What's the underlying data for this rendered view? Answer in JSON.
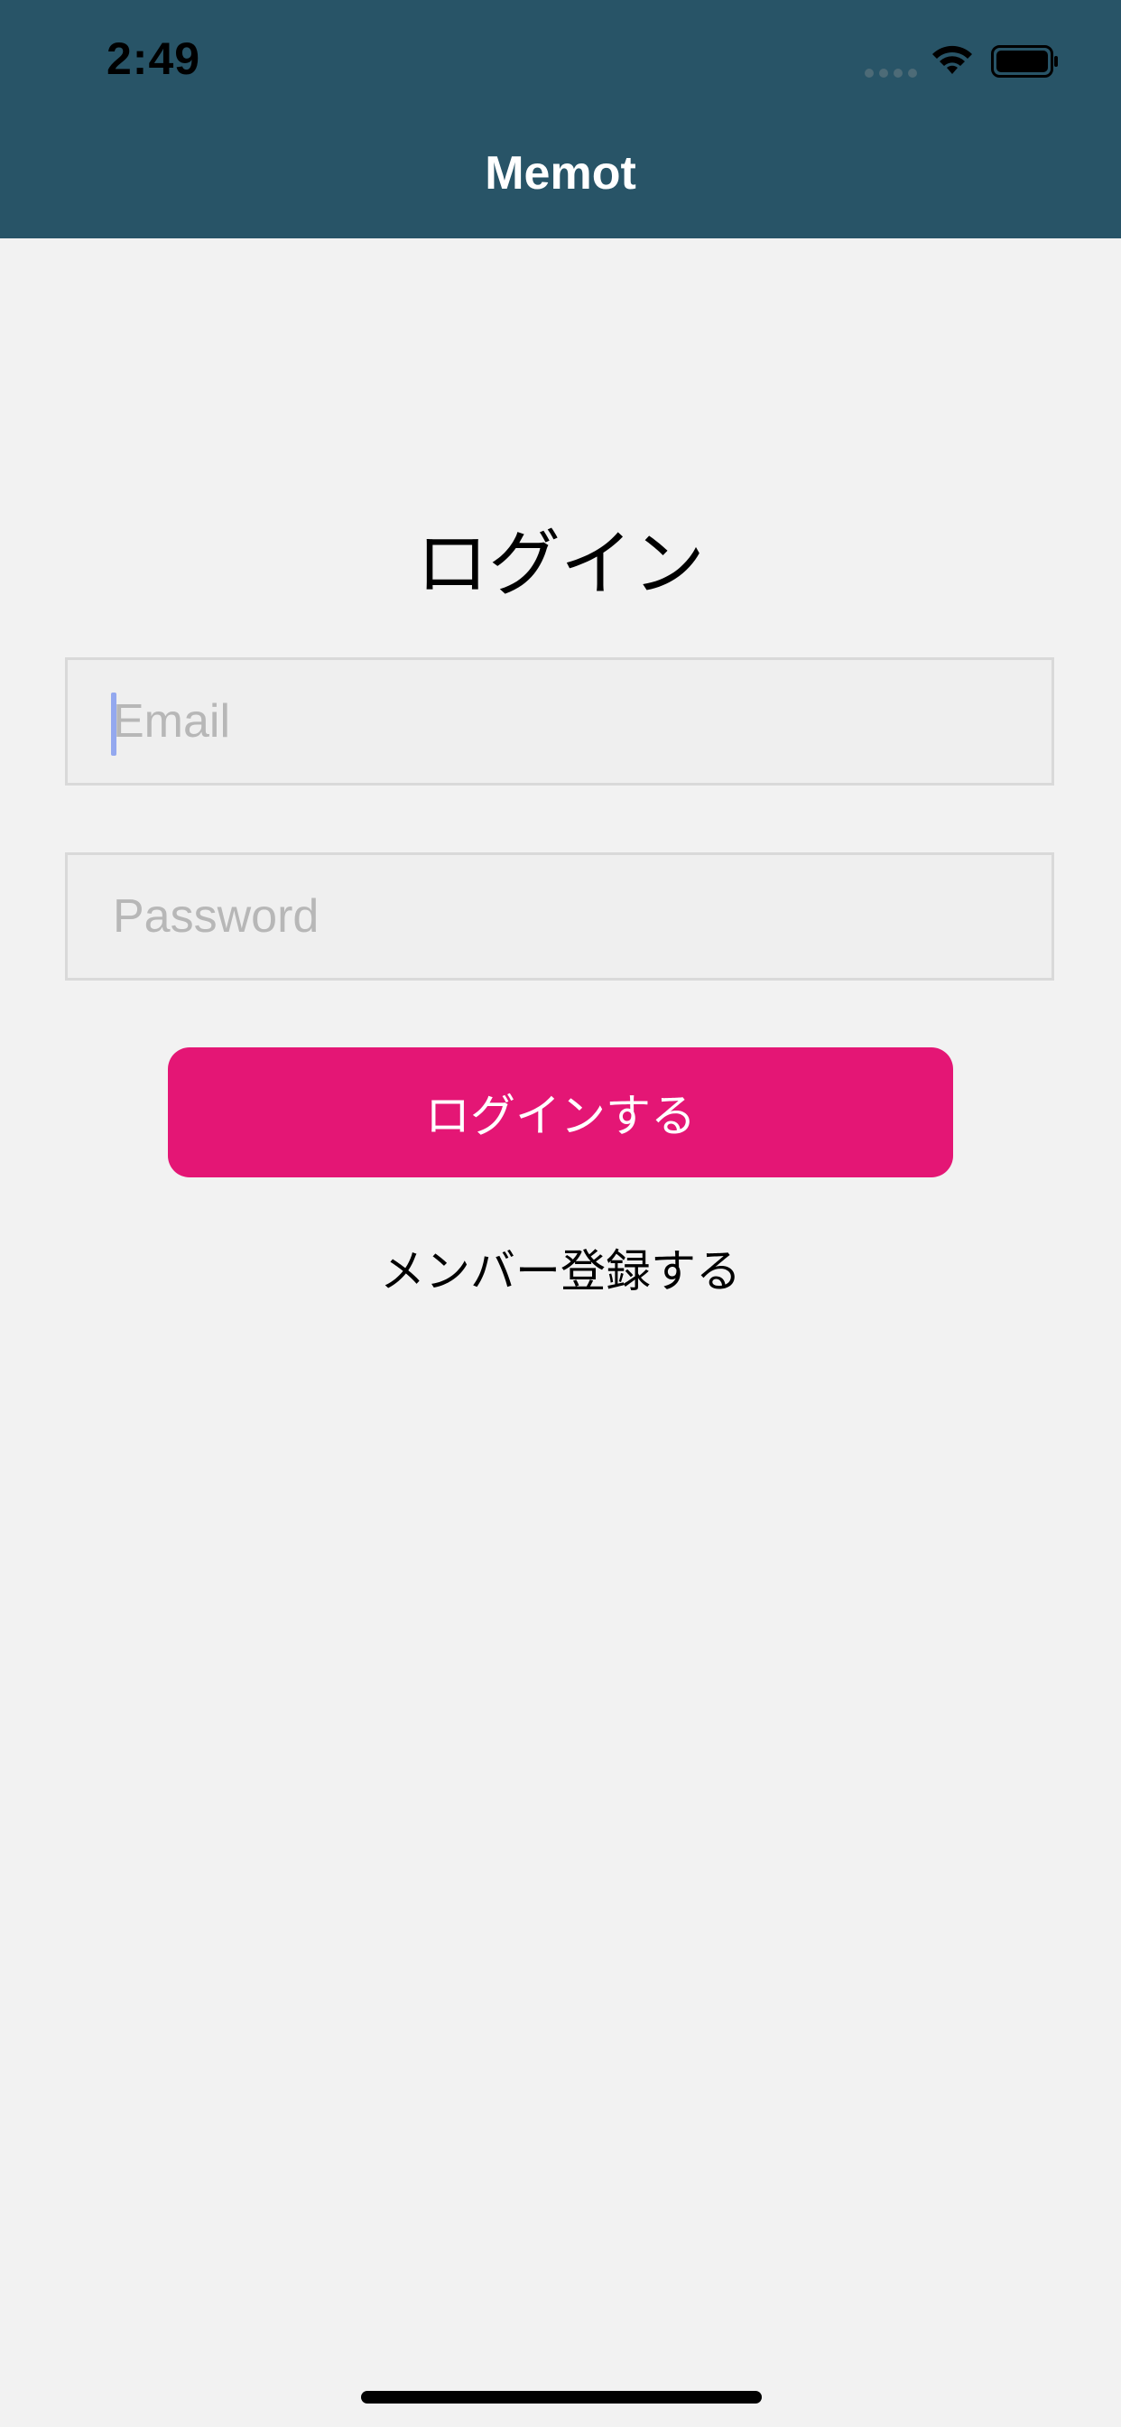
{
  "status_bar": {
    "time": "2:49",
    "icons": [
      "signal-dots-icon",
      "wifi-icon",
      "battery-icon"
    ]
  },
  "nav": {
    "title": "Memot"
  },
  "login": {
    "title": "ログイン",
    "email_placeholder": "Email",
    "email_value": "",
    "password_placeholder": "Password",
    "password_value": "",
    "submit_label": "ログインする",
    "register_label": "メンバー登録する"
  },
  "colors": {
    "header": "#285467",
    "background": "#f2f2f2",
    "accent": "#e41675",
    "cursor": "#93a8ef"
  }
}
